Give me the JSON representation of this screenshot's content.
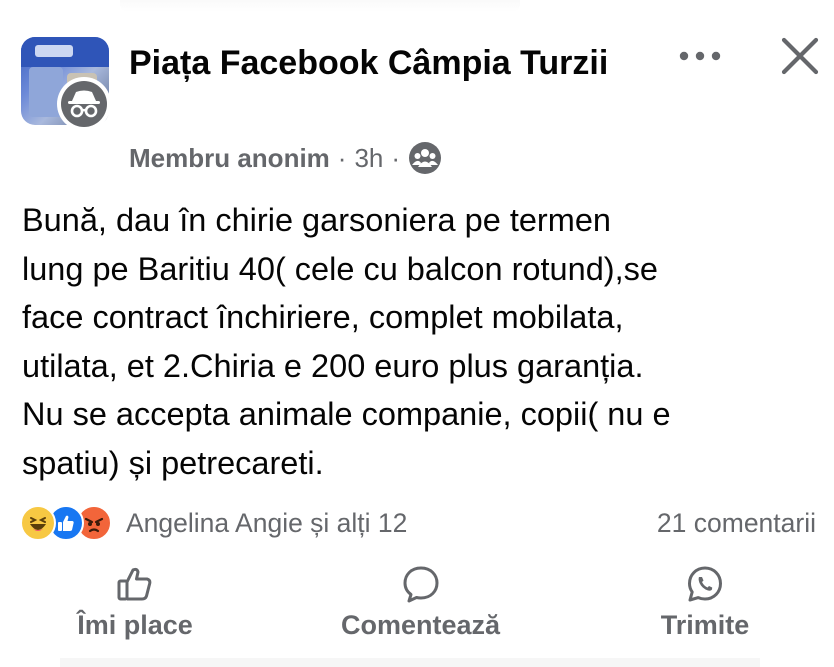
{
  "post": {
    "group_name": "Piața Facebook Câmpia Turzii",
    "author": "Membru anonim",
    "separator": "·",
    "time": "3h",
    "audience_icon": "group-audience-icon",
    "body_lines": [
      "Bună, dau în chirie garsoniera  pe termen",
      "lung pe Baritiu 40( cele cu balcon rotund),se",
      "face contract închiriere, complet mobilata,",
      "utilata, et 2.Chiria e 200 euro plus garanția.",
      "Nu se accepta animale companie, copii( nu e",
      "spatiu) și petrecareti."
    ]
  },
  "reactions": {
    "icons": [
      "haha-icon",
      "like-icon",
      "angry-icon"
    ],
    "summary": "Angelina Angie și alți 12",
    "comments": "21 comentarii"
  },
  "actions": {
    "like_label": "Îmi place",
    "comment_label": "Comentează",
    "share_label": "Trimite"
  },
  "colors": {
    "text": "#050505",
    "secondary": "#65676b",
    "like_blue": "#1877f2",
    "haha_yellow": "#f7c843",
    "angry_orange": "#f2653a"
  }
}
